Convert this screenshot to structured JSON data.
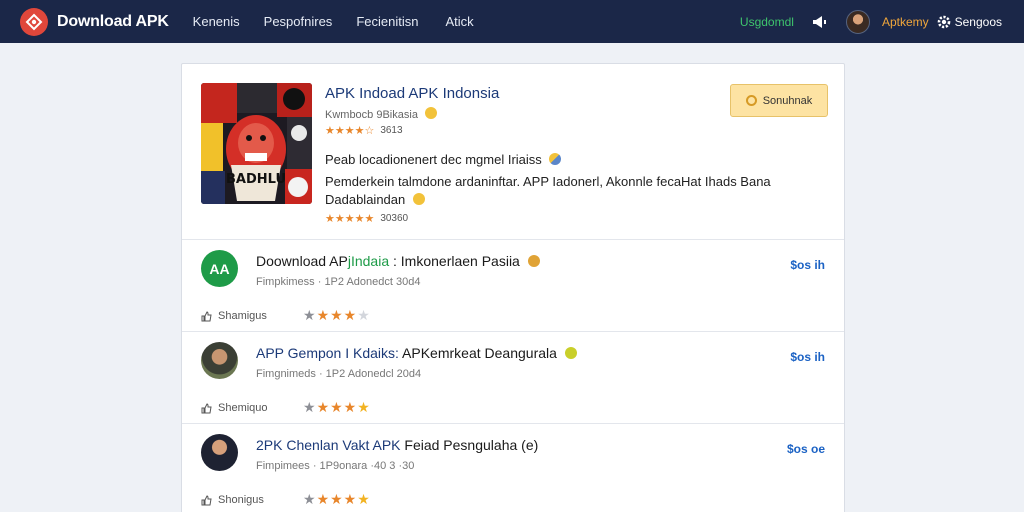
{
  "navbar": {
    "brand": "Download APK",
    "links": [
      "Kenenis",
      "Pespofnires",
      "Fecienitisn",
      "Atick"
    ],
    "green_link": "Usgdomdl",
    "user_name": "Aptkemy",
    "settings_label": "Sengoos",
    "colors": {
      "bg": "#1b2748",
      "logo": "#e0473b",
      "green": "#3ec46d",
      "user": "#f0a63b"
    }
  },
  "featured": {
    "title": "APK Indoad APK Indonsia",
    "subtitle": "Kwmbocb 9Bikasia",
    "rating_top": "3613",
    "desc_line1": "Peab locadionenert dec mgmel Iriaiss",
    "desc_line2": "Pemderkein talmdone ardaninftar. APP Iadonerl, Akonnle fecaHat Ihads Bana",
    "desc_line3": "Dadablaindan",
    "rating_bottom": "30360",
    "button_label": "Sonuhnak",
    "image_caption": "BADHLU",
    "colors": {
      "title": "#1c3a78",
      "stars": "#e8862b",
      "button_bg": "#fde3a3"
    }
  },
  "items": [
    {
      "title_part1": "Doownload AP",
      "title_part2": "jIndaia",
      "title_part3": " : Imkonerlaen Pasiia",
      "subtitle": "Fimpkimess · 1P2 Adonedct 30d4",
      "price": "$os ih",
      "share_label": "Shamigus",
      "stars": 3,
      "avatar_text": "AA"
    },
    {
      "title_part1": "APP Gempon I Kdaiks: ",
      "title_part2": "APKemrkeat",
      "title_part3": " Deangurala",
      "subtitle": "Fimgnimeds · 1P2 Adonedcl 20d4",
      "price": "$os ih",
      "share_label": "Shemiquo",
      "stars": 4
    },
    {
      "title_part1": "2PK Chenlan Vakt APK",
      "title_part2": " Feiad",
      "title_part3": " Pesngulaha (e)",
      "subtitle": "Fimpimees · 1P9onara ·40 3 ·30",
      "price": "$os oe",
      "share_label": "Shonigus",
      "stars": 4
    }
  ]
}
